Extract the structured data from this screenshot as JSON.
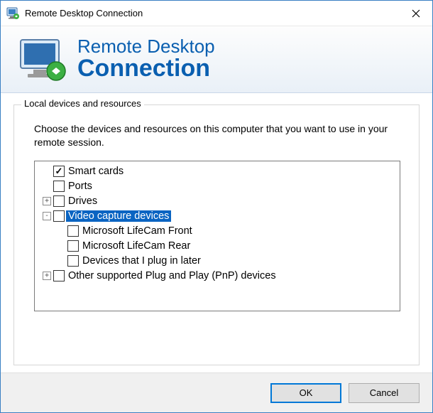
{
  "titlebar": {
    "title": "Remote Desktop Connection"
  },
  "banner": {
    "line1": "Remote Desktop",
    "line2": "Connection"
  },
  "group": {
    "legend": "Local devices and resources",
    "instructions": "Choose the devices and resources on this computer that you want to use in your remote session."
  },
  "tree": {
    "items": [
      {
        "indent": 0,
        "expander": "",
        "checked": true,
        "label": "Smart cards",
        "selected": false,
        "name": "tree-item-smart-cards"
      },
      {
        "indent": 0,
        "expander": "",
        "checked": false,
        "label": "Ports",
        "selected": false,
        "name": "tree-item-ports"
      },
      {
        "indent": 0,
        "expander": "+",
        "checked": false,
        "label": "Drives",
        "selected": false,
        "name": "tree-item-drives"
      },
      {
        "indent": 0,
        "expander": "-",
        "checked": false,
        "label": "Video capture devices",
        "selected": true,
        "name": "tree-item-video-capture"
      },
      {
        "indent": 1,
        "expander": "",
        "checked": false,
        "label": "Microsoft LifeCam Front",
        "selected": false,
        "name": "tree-item-lifecam-front"
      },
      {
        "indent": 1,
        "expander": "",
        "checked": false,
        "label": "Microsoft LifeCam Rear",
        "selected": false,
        "name": "tree-item-lifecam-rear"
      },
      {
        "indent": 1,
        "expander": "",
        "checked": false,
        "label": "Devices that I plug in later",
        "selected": false,
        "name": "tree-item-plug-later"
      },
      {
        "indent": 0,
        "expander": "+",
        "checked": false,
        "label": "Other supported Plug and Play (PnP) devices",
        "selected": false,
        "name": "tree-item-pnp"
      }
    ]
  },
  "buttons": {
    "ok": "OK",
    "cancel": "Cancel"
  }
}
